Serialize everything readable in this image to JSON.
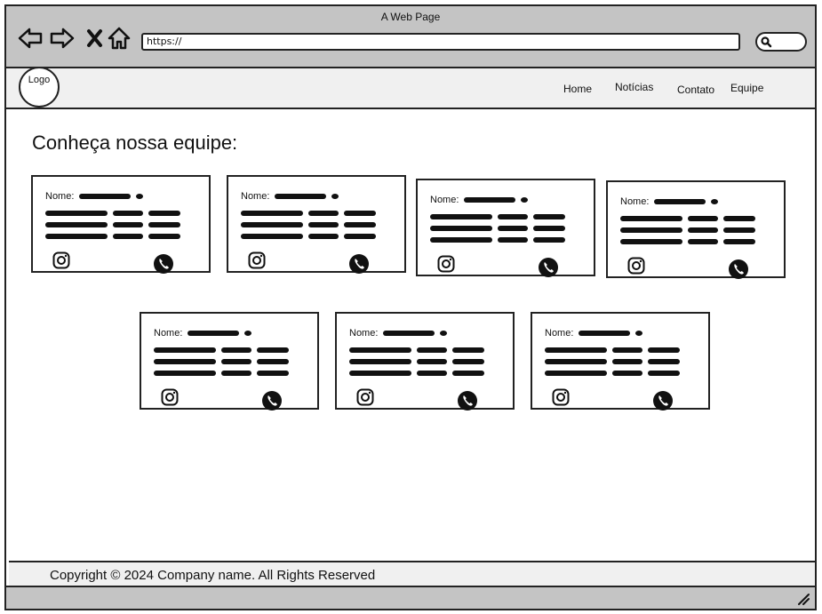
{
  "window": {
    "title": "A Web Page"
  },
  "browser": {
    "url": "https://",
    "icons": [
      "back-arrow-icon",
      "forward-arrow-icon",
      "close-x-icon",
      "home-icon",
      "search-icon"
    ]
  },
  "site_nav": {
    "logo": "Logo",
    "links": [
      "Home",
      "Notícias",
      "Contato",
      "Equipe"
    ]
  },
  "main": {
    "heading": "Conheça nossa equipe:",
    "cards": [
      {
        "label": "Nome:"
      },
      {
        "label": "Nome:"
      },
      {
        "label": "Nome:"
      },
      {
        "label": "Nome:"
      },
      {
        "label": "Nome:"
      },
      {
        "label": "Nome:"
      },
      {
        "label": "Nome:"
      }
    ]
  },
  "footer": {
    "copyright": "Copyright © 2024 Company name. All Rights Reserved"
  }
}
